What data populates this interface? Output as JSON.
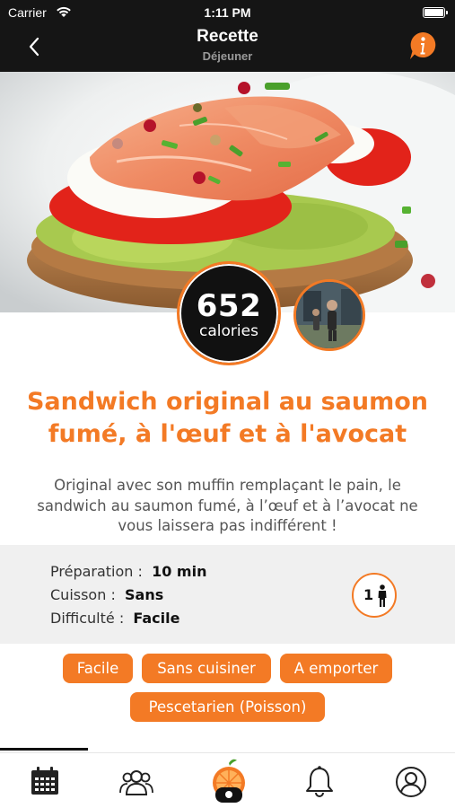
{
  "status_bar": {
    "carrier": "Carrier",
    "time": "1:11 PM"
  },
  "nav": {
    "title": "Recette",
    "subtitle": "Déjeuner",
    "back_icon": "chevron-left-icon",
    "info_icon": "info-bubble-icon"
  },
  "hero": {
    "image": "smoked-salmon-egg-avocado-sandwich-photo"
  },
  "calories": {
    "value": "652",
    "unit": "calories"
  },
  "recipe": {
    "title": "Sandwich original au saumon fumé, à l'œuf et à l'avocat",
    "description": "Original avec son muffin remplaçant le pain, le sandwich au saumon fumé, à l’œuf et à l’avocat ne vous laissera pas indifférent !"
  },
  "details": {
    "preparation_label": "Préparation :",
    "preparation_value": "10 min",
    "cuisson_label": "Cuisson :",
    "cuisson_value": "Sans",
    "difficulte_label": "Difficulté :",
    "difficulte_value": "Facile",
    "servings": "1"
  },
  "tags": [
    "Facile",
    "Sans cuisiner",
    "A emporter",
    "Pescetarien (Poisson)"
  ],
  "tab_bar": {
    "items": [
      "calendar-icon",
      "community-icon",
      "app-logo-icon",
      "bell-icon",
      "profile-icon"
    ]
  },
  "colors": {
    "accent": "#f37a25",
    "header_bg": "#151515",
    "panel_bg": "#f0f0f0"
  }
}
